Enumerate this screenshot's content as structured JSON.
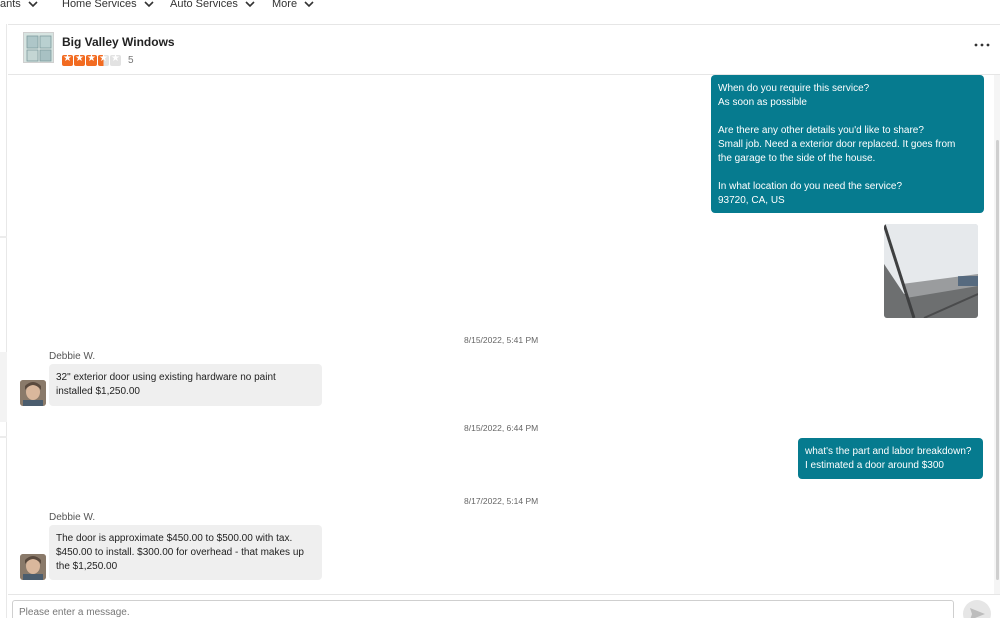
{
  "nav": {
    "items": [
      {
        "label": "ants"
      },
      {
        "label": "Home Services"
      },
      {
        "label": "Auto Services"
      },
      {
        "label": "More"
      }
    ]
  },
  "business": {
    "name": "Big Valley Windows",
    "rating": 3.5,
    "rating_max": 5,
    "review_count": "5"
  },
  "messages": {
    "outgoing_1": [
      "When do you require this service?",
      "As soon as possible",
      "",
      "Are there any other details you'd like to share?",
      "Small job. Need a exterior door replaced. It goes from",
      "the garage to the side of the house.",
      "",
      "In what location do you need the service?",
      "93720, CA, US"
    ],
    "stamp_1": "8/15/2022, 5:41 PM",
    "sender_1": "Debbie W.",
    "incoming_1": [
      "32\" exterior door using existing hardware no paint",
      "installed $1,250.00"
    ],
    "stamp_2": "8/15/2022, 6:44 PM",
    "outgoing_2": [
      "what's the part and labor breakdown?",
      "I estimated a door around $300"
    ],
    "stamp_3": "8/17/2022, 5:14 PM",
    "sender_2": "Debbie W.",
    "incoming_2": [
      "The door is approximate $450.00 to $500.00 with tax.",
      "$450.00 to install. $300.00 for overhead - that makes up",
      "the $1,250.00"
    ]
  },
  "composer": {
    "placeholder": "Please enter a message."
  },
  "colors": {
    "brand_teal": "#067b8f",
    "star_orange": "#f26b21"
  },
  "icons": {
    "nav_chevron": "chevron-down-icon",
    "more": "more-horizontal-icon",
    "send": "send-icon"
  }
}
